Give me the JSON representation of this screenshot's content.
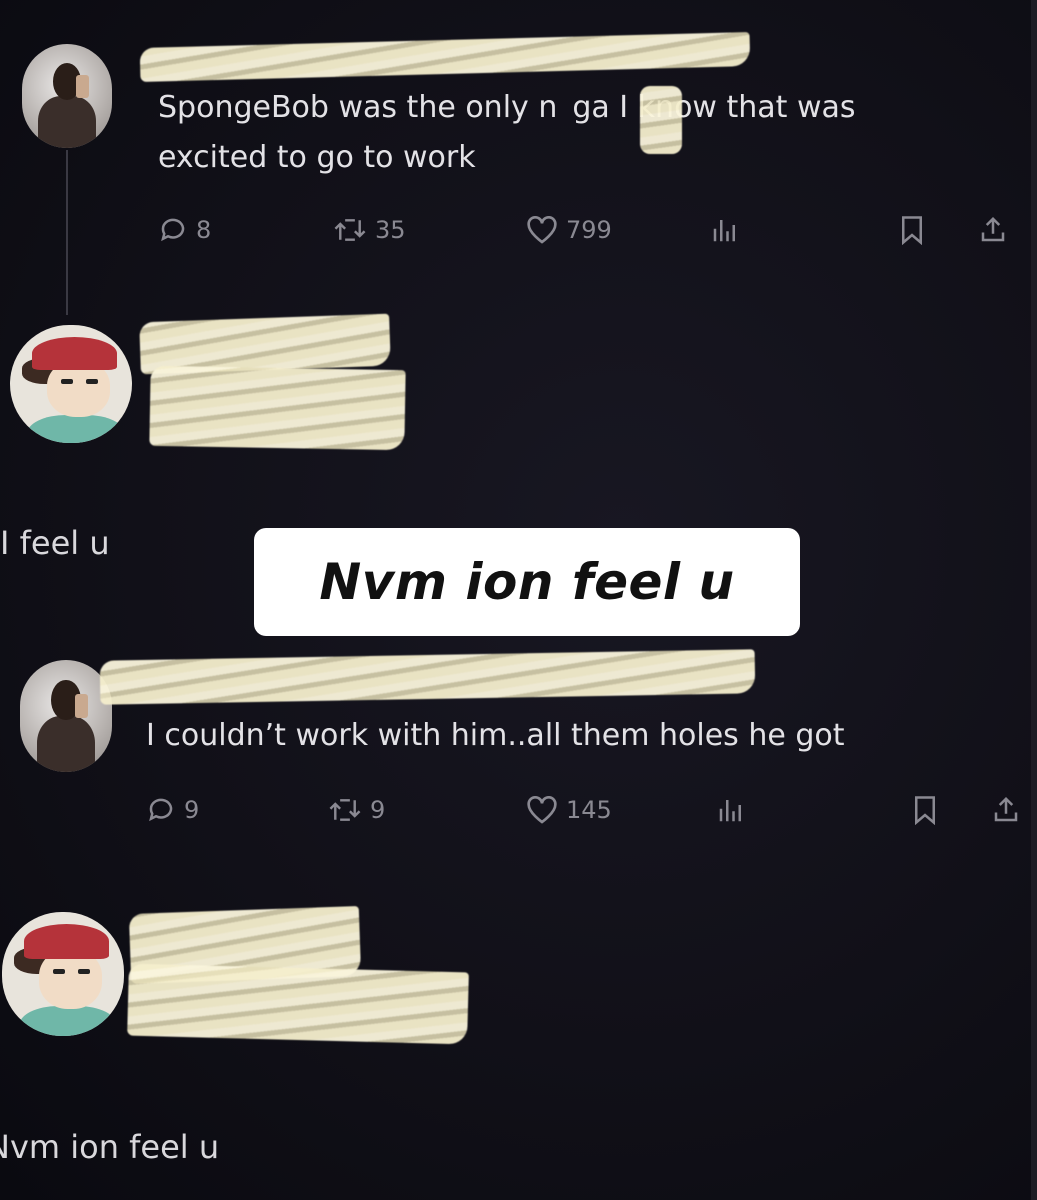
{
  "tweet1": {
    "text_line1": "SpongeBob was the only n  ga I know that was",
    "text_line2": "excited to go to work",
    "replies": "8",
    "retweets": "35",
    "likes": "799"
  },
  "reply1": {
    "text": "I feel u"
  },
  "overlay": {
    "caption": "Nvm ion feel u"
  },
  "tweet2": {
    "text": "I couldn’t work with him..all them holes he got",
    "replies": "9",
    "retweets": "9",
    "likes": "145"
  },
  "reply2": {
    "text": "Nvm ion feel u"
  },
  "icons": {
    "reply": "reply-icon",
    "retweet": "retweet-icon",
    "like": "heart-icon",
    "views": "views-icon",
    "bookmark": "bookmark-icon",
    "share": "share-icon"
  },
  "colors": {
    "background": "#0d0c14",
    "text": "#e3e2e6",
    "muted": "#8a8992",
    "redaction": "#f5eecd"
  }
}
